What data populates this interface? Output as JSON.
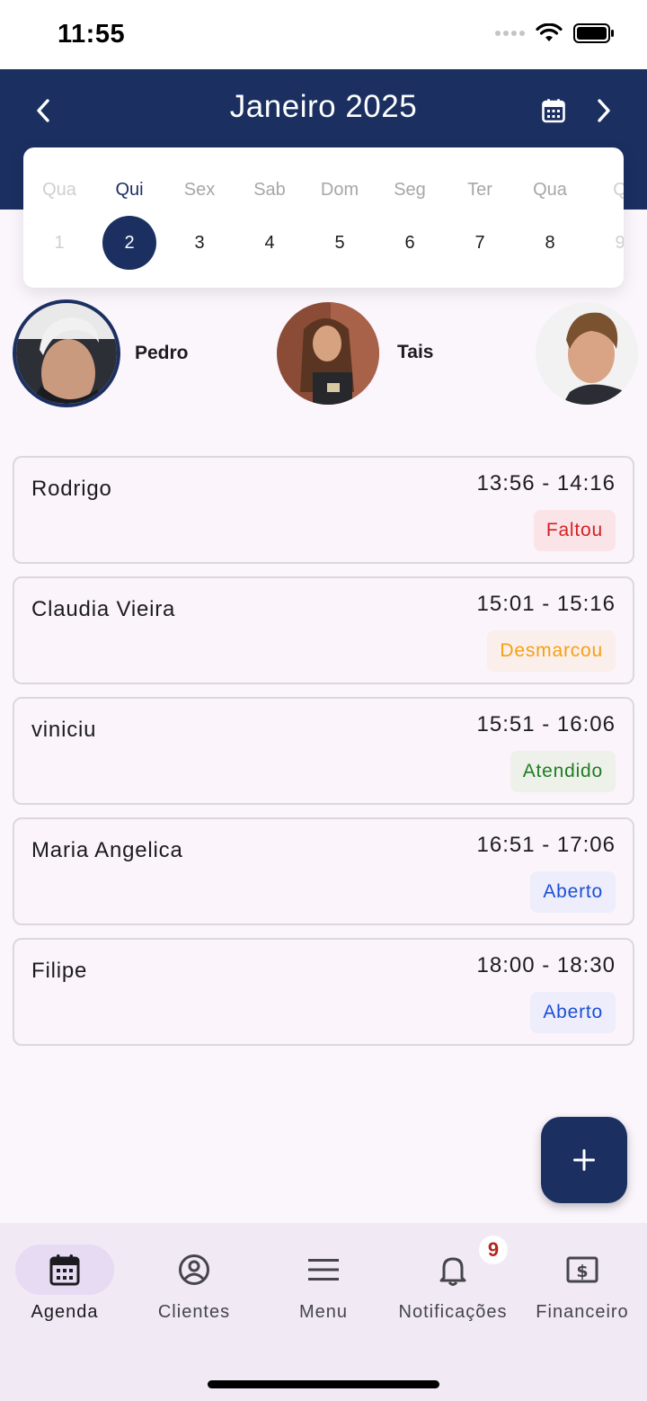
{
  "status_bar": {
    "time": "11:55"
  },
  "header": {
    "title": "Janeiro 2025",
    "prev_icon": "chevron-left-icon",
    "next_icon": "chevron-right-icon",
    "calendar_icon": "calendar-icon"
  },
  "days": [
    {
      "name": "Qua",
      "num": "1",
      "state": "faded"
    },
    {
      "name": "Qui",
      "num": "2",
      "state": "selected"
    },
    {
      "name": "Sex",
      "num": "3",
      "state": ""
    },
    {
      "name": "Sab",
      "num": "4",
      "state": ""
    },
    {
      "name": "Dom",
      "num": "5",
      "state": ""
    },
    {
      "name": "Seg",
      "num": "6",
      "state": ""
    },
    {
      "name": "Ter",
      "num": "7",
      "state": ""
    },
    {
      "name": "Qua",
      "num": "8",
      "state": ""
    },
    {
      "name": "Q",
      "num": "9",
      "state": "faded"
    }
  ],
  "professionals": [
    {
      "name": "Pedro",
      "selected": true
    },
    {
      "name": "Tais",
      "selected": false
    },
    {
      "name": "",
      "selected": false
    }
  ],
  "appointments": [
    {
      "client": "Rodrigo",
      "time": "13:56 - 14:16",
      "status": "Faltou",
      "status_color": "#d32020",
      "status_bg": "#fbe4e8"
    },
    {
      "client": "Claudia Vieira",
      "time": "15:01 - 15:16",
      "status": "Desmarcou",
      "status_color": "#f5a011",
      "status_bg": "#fbefec"
    },
    {
      "client": "viniciu",
      "time": "15:51 - 16:06",
      "status": "Atendido",
      "status_color": "#1e7d23",
      "status_bg": "#eef0ea"
    },
    {
      "client": "Maria Angelica",
      "time": "16:51 - 17:06",
      "status": "Aberto",
      "status_color": "#1a4fd6",
      "status_bg": "#eeedfb"
    },
    {
      "client": "Filipe",
      "time": "18:00 - 18:30",
      "status": "Aberto",
      "status_color": "#1a4fd6",
      "status_bg": "#eeedfb"
    }
  ],
  "fab": {
    "icon": "plus-icon"
  },
  "bottom_nav": [
    {
      "label": "Agenda",
      "icon": "calendar-icon",
      "active": true
    },
    {
      "label": "Clientes",
      "icon": "user-circle-icon",
      "active": false
    },
    {
      "label": "Menu",
      "icon": "menu-icon",
      "active": false
    },
    {
      "label": "Notificações",
      "icon": "bell-icon",
      "active": false,
      "badge": "9"
    },
    {
      "label": "Financeiro",
      "icon": "dollar-icon",
      "active": false
    }
  ],
  "colors": {
    "primary": "#1b3061",
    "background": "#fbf5fc"
  }
}
